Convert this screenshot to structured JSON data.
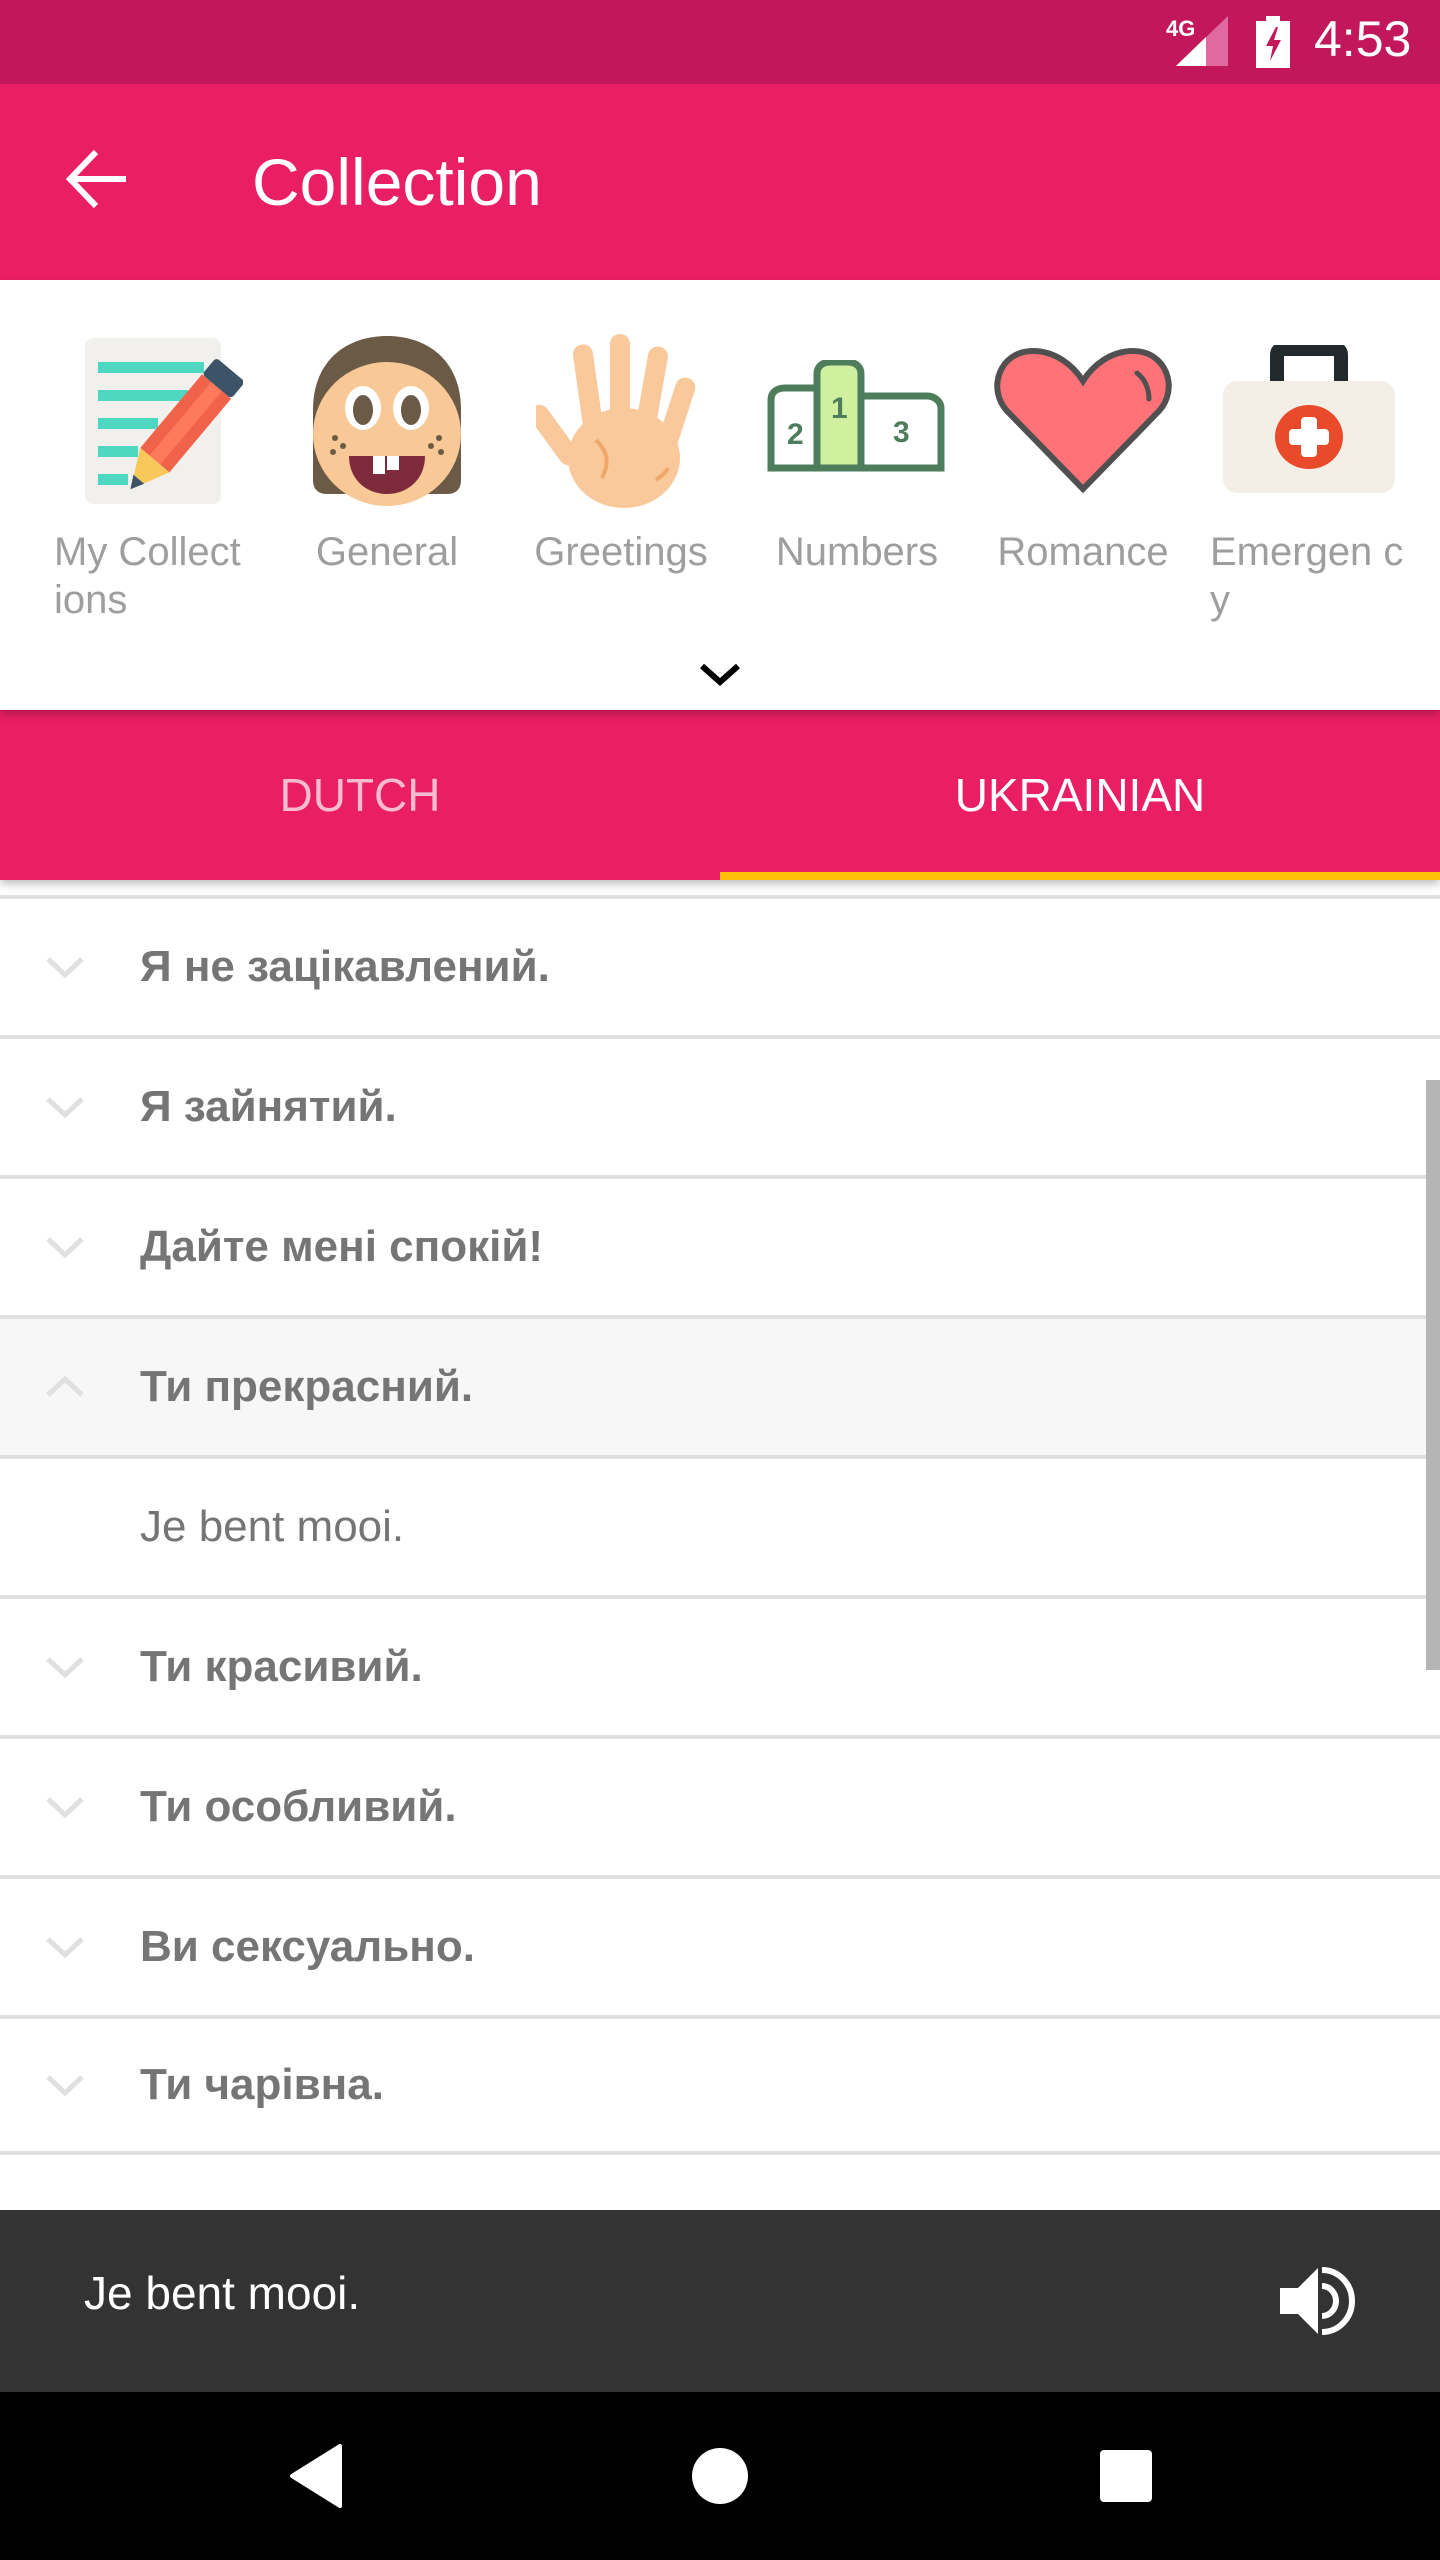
{
  "status_bar": {
    "network": "4G",
    "time": "4:53",
    "background": "#c2185b"
  },
  "app_bar": {
    "title": "Collection",
    "back_icon": "arrow-back-icon",
    "background": "#e91e63"
  },
  "categories": [
    {
      "label": "My Collections",
      "display": "My Collect ions",
      "icon": "notepad-pencil-icon"
    },
    {
      "label": "General",
      "display": "General",
      "icon": "smiling-face-icon"
    },
    {
      "label": "Greetings",
      "display": "Greetings",
      "icon": "waving-hand-icon"
    },
    {
      "label": "Numbers",
      "display": "Numbers",
      "icon": "podium-icon"
    },
    {
      "label": "Romance",
      "display": "Romance",
      "icon": "heart-icon"
    },
    {
      "label": "Emergency",
      "display": "Emergen cy",
      "icon": "first-aid-kit-icon"
    }
  ],
  "expand_icon": "chevron-down-icon",
  "tabs": [
    {
      "label": "DUTCH",
      "active": false
    },
    {
      "label": "UKRAINIAN",
      "active": true
    }
  ],
  "tab_indicator_color": "#ffc107",
  "phrases": [
    {
      "text": "Я не зацікавлений.",
      "expanded": false
    },
    {
      "text": "Я зайнятий.",
      "expanded": false
    },
    {
      "text": "Дайте мені спокій!",
      "expanded": false
    },
    {
      "text": "Ти прекрасний.",
      "expanded": true,
      "translation": "Je bent mooi."
    },
    {
      "text": "Ти красивий.",
      "expanded": false
    },
    {
      "text": "Ти особливий.",
      "expanded": false
    },
    {
      "text": "Ви сексуально.",
      "expanded": false
    },
    {
      "text": "Ти чарівна.",
      "expanded": false
    }
  ],
  "player": {
    "text": "Je bent mooi.",
    "icon": "speaker-icon"
  },
  "navigation": {
    "back": "nav-back-icon",
    "home": "nav-home-icon",
    "recents": "nav-recents-icon"
  }
}
